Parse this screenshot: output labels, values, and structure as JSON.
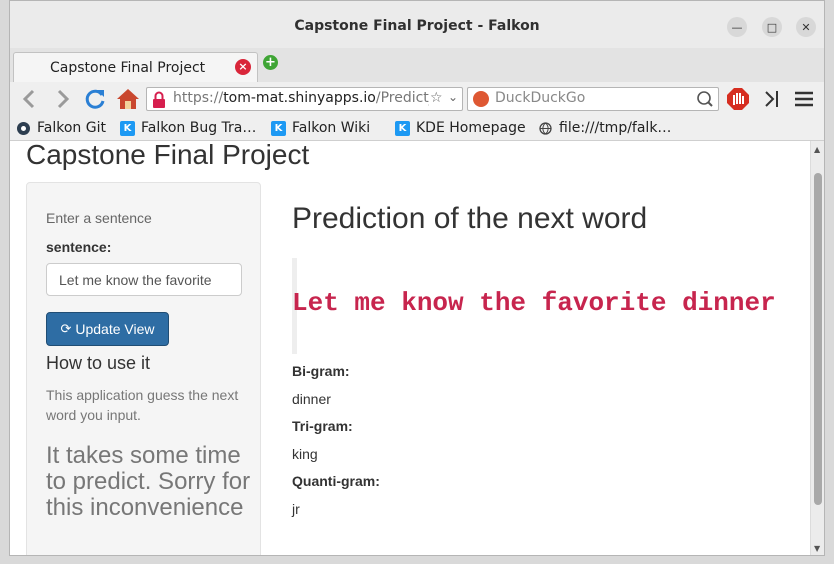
{
  "window": {
    "title": "Capstone Final Project - Falkon"
  },
  "tab": {
    "label": "Capstone Final Project"
  },
  "url": {
    "scheme": "https://",
    "host": "tom-mat.shinyapps.io",
    "path": "/Predict_"
  },
  "search": {
    "placeholder": "DuckDuckGo"
  },
  "bookmarks": [
    "Falkon Git",
    "Falkon Bug Tra…",
    "Falkon Wiki",
    "KDE Homepage",
    "file:///tmp/falk…"
  ],
  "page": {
    "title": "Capstone Final Project",
    "sidebar": {
      "hint": "Enter a sentence",
      "label": "sentence:",
      "input_value": "Let me know the favorite",
      "button_label": "Update View",
      "how_title": "How to use it",
      "how_text": "This application guess the next word you input.",
      "note": "It takes some time to predict. Sorry for this inconvenience"
    },
    "main": {
      "heading": "Prediction of the next word",
      "prediction": "Let me know the favorite dinner",
      "bigram_label": "Bi-gram:",
      "bigram_value": "dinner",
      "trigram_label": "Tri-gram:",
      "trigram_value": "king",
      "quantigram_label": "Quanti-gram:",
      "quantigram_value": "jr"
    }
  },
  "colors": {
    "primary_button": "#2e6da4",
    "prediction_text": "#c7254e",
    "close_icon": "#d9263a",
    "add_tab_icon": "#3fa535"
  }
}
